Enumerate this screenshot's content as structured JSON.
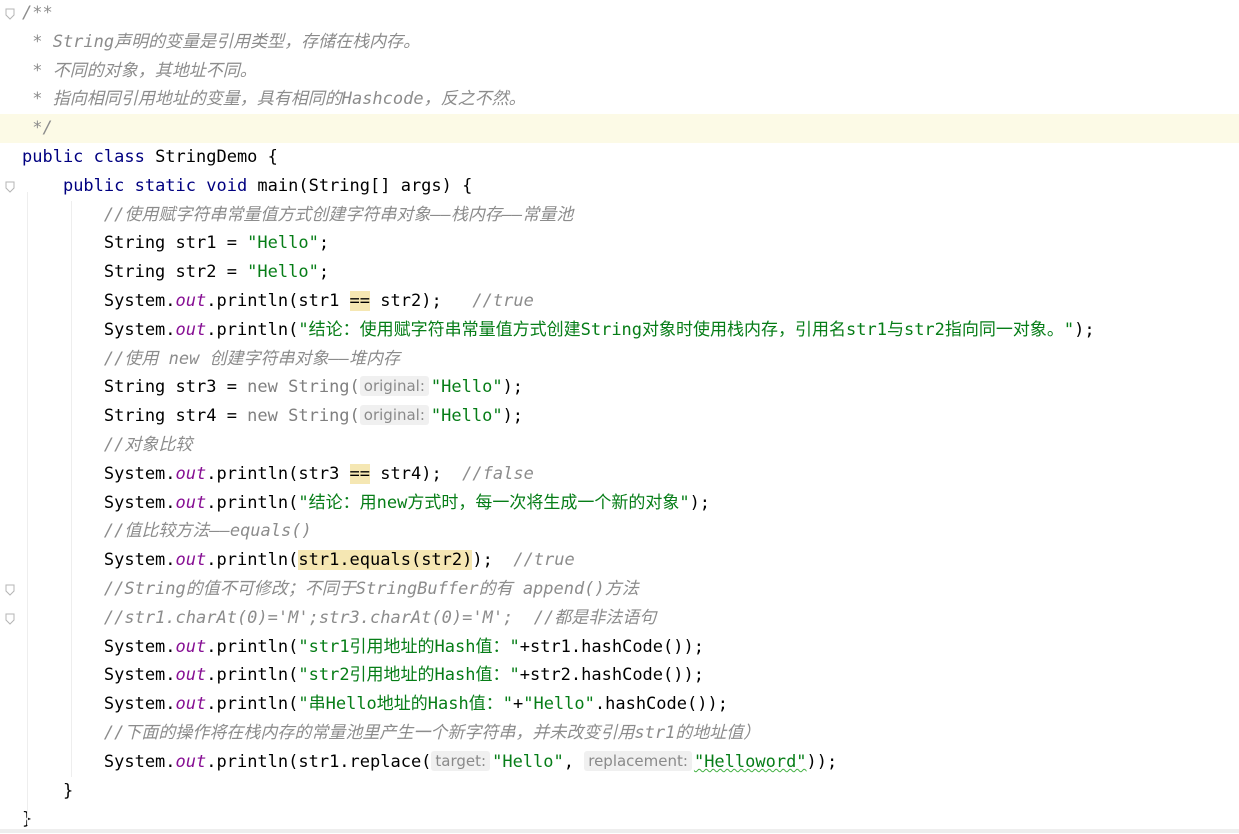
{
  "editor": {
    "lines": [
      {
        "id": "l1",
        "segments": [
          {
            "c": "cm",
            "t": "/**"
          }
        ]
      },
      {
        "id": "l2",
        "segments": [
          {
            "c": "cm",
            "t": " * String声明的变量是引用类型，存储在栈内存。"
          }
        ]
      },
      {
        "id": "l3",
        "segments": [
          {
            "c": "cm",
            "t": " * 不同的对象，其地址不同。"
          }
        ]
      },
      {
        "id": "l4",
        "segments": [
          {
            "c": "cm",
            "t": " * 指向相同引用地址的变量，具有相同的Hashcode，反之不然。"
          }
        ]
      },
      {
        "id": "l5",
        "segments": [
          {
            "c": "cm",
            "t": " */"
          }
        ]
      },
      {
        "id": "l6",
        "segments": [
          {
            "c": "kw",
            "t": "public class "
          },
          {
            "c": "",
            "t": "StringDemo {"
          }
        ]
      },
      {
        "id": "l7",
        "segments": [
          {
            "c": "",
            "t": "    "
          },
          {
            "c": "kw",
            "t": "public static void "
          },
          {
            "c": "",
            "t": "main(String[] args) {"
          }
        ]
      },
      {
        "id": "l8",
        "segments": [
          {
            "c": "",
            "t": "        "
          },
          {
            "c": "cm",
            "t": "//使用赋字符串常量值方式创建字符串对象——栈内存——常量池"
          }
        ]
      },
      {
        "id": "l9",
        "segments": [
          {
            "c": "",
            "t": "        String str1 = "
          },
          {
            "c": "str",
            "t": "\"Hello\""
          },
          {
            "c": "",
            "t": ";"
          }
        ]
      },
      {
        "id": "l10",
        "segments": [
          {
            "c": "",
            "t": "        String str2 = "
          },
          {
            "c": "str",
            "t": "\"Hello\""
          },
          {
            "c": "",
            "t": ";"
          }
        ]
      },
      {
        "id": "l11",
        "segments": [
          {
            "c": "",
            "t": "        System."
          },
          {
            "c": "field",
            "t": "out"
          },
          {
            "c": "",
            "t": ".println(str1 "
          },
          {
            "c": "match",
            "t": "=="
          },
          {
            "c": "",
            "t": " str2);   "
          },
          {
            "c": "cm",
            "t": "//true"
          }
        ]
      },
      {
        "id": "l12",
        "segments": [
          {
            "c": "",
            "t": "        System."
          },
          {
            "c": "field",
            "t": "out"
          },
          {
            "c": "",
            "t": ".println("
          },
          {
            "c": "str",
            "t": "\"结论：使用赋字符串常量值方式创建String对象时使用栈内存，引用名str1与str2指向同一对象。\""
          },
          {
            "c": "",
            "t": ");"
          }
        ]
      },
      {
        "id": "l13",
        "segments": [
          {
            "c": "",
            "t": "        "
          },
          {
            "c": "cm",
            "t": "//使用 new 创建字符串对象——堆内存"
          }
        ]
      },
      {
        "id": "l14",
        "segments": [
          {
            "c": "",
            "t": "        String str3 = "
          },
          {
            "c": "gray",
            "t": "new "
          },
          {
            "c": "gray",
            "t": "String("
          },
          {
            "c": "hint",
            "t": "original:"
          },
          {
            "c": "str",
            "t": "\"Hello\""
          },
          {
            "c": "",
            "t": ");"
          }
        ]
      },
      {
        "id": "l15",
        "segments": [
          {
            "c": "",
            "t": "        String str4 = "
          },
          {
            "c": "gray",
            "t": "new "
          },
          {
            "c": "gray",
            "t": "String("
          },
          {
            "c": "hint",
            "t": "original:"
          },
          {
            "c": "str",
            "t": "\"Hello\""
          },
          {
            "c": "",
            "t": ");"
          }
        ]
      },
      {
        "id": "l16",
        "segments": [
          {
            "c": "",
            "t": "        "
          },
          {
            "c": "cm",
            "t": "//对象比较"
          }
        ]
      },
      {
        "id": "l17",
        "segments": [
          {
            "c": "",
            "t": "        System."
          },
          {
            "c": "field",
            "t": "out"
          },
          {
            "c": "",
            "t": ".println(str3 "
          },
          {
            "c": "match",
            "t": "=="
          },
          {
            "c": "",
            "t": " str4);  "
          },
          {
            "c": "cm",
            "t": "//false"
          }
        ]
      },
      {
        "id": "l18",
        "segments": [
          {
            "c": "",
            "t": "        System."
          },
          {
            "c": "field",
            "t": "out"
          },
          {
            "c": "",
            "t": ".println("
          },
          {
            "c": "str",
            "t": "\"结论：用new方式时，每一次将生成一个新的对象\""
          },
          {
            "c": "",
            "t": ");"
          }
        ]
      },
      {
        "id": "l19",
        "segments": [
          {
            "c": "",
            "t": "        "
          },
          {
            "c": "cm",
            "t": "//值比较方法——equals()"
          }
        ]
      },
      {
        "id": "l20",
        "segments": [
          {
            "c": "",
            "t": "        System."
          },
          {
            "c": "field",
            "t": "out"
          },
          {
            "c": "",
            "t": ".println("
          },
          {
            "c": "match",
            "t": "str1.equals(str2)"
          },
          {
            "c": "",
            "t": ");  "
          },
          {
            "c": "cm",
            "t": "//true"
          }
        ]
      },
      {
        "id": "l21",
        "segments": [
          {
            "c": "",
            "t": "        "
          },
          {
            "c": "cm",
            "t": "//String的值不可修改；不同于StringBuffer的有 append()方法"
          }
        ]
      },
      {
        "id": "l22",
        "segments": [
          {
            "c": "",
            "t": "        "
          },
          {
            "c": "cm",
            "t": "//str1.charAt(0)='M';str3.charAt(0)='M';  //都是非法语句"
          }
        ]
      },
      {
        "id": "l23",
        "segments": [
          {
            "c": "",
            "t": "        System."
          },
          {
            "c": "field",
            "t": "out"
          },
          {
            "c": "",
            "t": ".println("
          },
          {
            "c": "str",
            "t": "\"str1引用地址的Hash值：\""
          },
          {
            "c": "",
            "t": "+str1.hashCode());"
          }
        ]
      },
      {
        "id": "l24",
        "segments": [
          {
            "c": "",
            "t": "        System."
          },
          {
            "c": "field",
            "t": "out"
          },
          {
            "c": "",
            "t": ".println("
          },
          {
            "c": "str",
            "t": "\"str2引用地址的Hash值：\""
          },
          {
            "c": "",
            "t": "+str2.hashCode());"
          }
        ]
      },
      {
        "id": "l25",
        "segments": [
          {
            "c": "",
            "t": "        System."
          },
          {
            "c": "field",
            "t": "out"
          },
          {
            "c": "",
            "t": ".println("
          },
          {
            "c": "str",
            "t": "\"串Hello地址的Hash值：\""
          },
          {
            "c": "",
            "t": "+"
          },
          {
            "c": "str",
            "t": "\"Hello\""
          },
          {
            "c": "",
            "t": ".hashCode());"
          }
        ]
      },
      {
        "id": "l26",
        "segments": [
          {
            "c": "",
            "t": "        "
          },
          {
            "c": "cm",
            "t": "//下面的操作将在栈内存的常量池里产生一个新字符串，并未改变引用str1的地址值）"
          }
        ]
      },
      {
        "id": "l27",
        "segments": [
          {
            "c": "",
            "t": "        System."
          },
          {
            "c": "field",
            "t": "out"
          },
          {
            "c": "",
            "t": ".println(str1.replace("
          },
          {
            "c": "hint",
            "t": "target:"
          },
          {
            "c": "str",
            "t": "\"Hello\""
          },
          {
            "c": "",
            "t": ", "
          },
          {
            "c": "hint",
            "t": "replacement:"
          },
          {
            "c": "str squig",
            "t": "\"Helloword\""
          },
          {
            "c": "",
            "t": "));"
          }
        ]
      },
      {
        "id": "l28",
        "segments": [
          {
            "c": "",
            "t": "    }"
          }
        ]
      },
      {
        "id": "l29",
        "segments": [
          {
            "c": "",
            "t": "}"
          }
        ]
      }
    ],
    "highlighted_line": "l5",
    "fold_marker_lines": [
      "l1",
      "l5",
      "l7",
      "l21",
      "l22"
    ]
  },
  "colors": {
    "keyword": "#000080",
    "string": "#067d17",
    "comment": "#8c8c8c",
    "field": "#871094",
    "match_highlight": "#f5e7b3",
    "current_line": "#fcfae6"
  }
}
